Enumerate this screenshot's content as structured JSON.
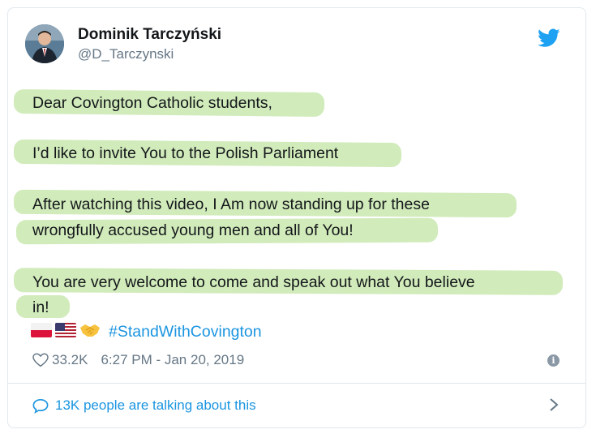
{
  "author": {
    "name": "Dominik Tarczyński",
    "handle": "@D_Tarczynski"
  },
  "tweet": {
    "lines": [
      "Dear Covington Catholic students,",
      "I’d like to invite You to the Polish Parliament",
      "After watching this video, I Am now standing up for these",
      "wrongfully accused young men and all of You!",
      "You are very welcome to come and speak out what You believe",
      "in!"
    ],
    "hashtag": "#StandWithCovington",
    "emoji_icons": [
      "flag-poland-icon",
      "flag-usa-icon",
      "handshake-icon"
    ]
  },
  "meta": {
    "likes": "33.2K",
    "timestamp": "6:27 PM - Jan 20, 2019"
  },
  "footer": {
    "talking": "13K people are talking about this"
  },
  "colors": {
    "highlight": "#cce9b4",
    "link": "#1b95e0",
    "secondary": "#657786"
  }
}
